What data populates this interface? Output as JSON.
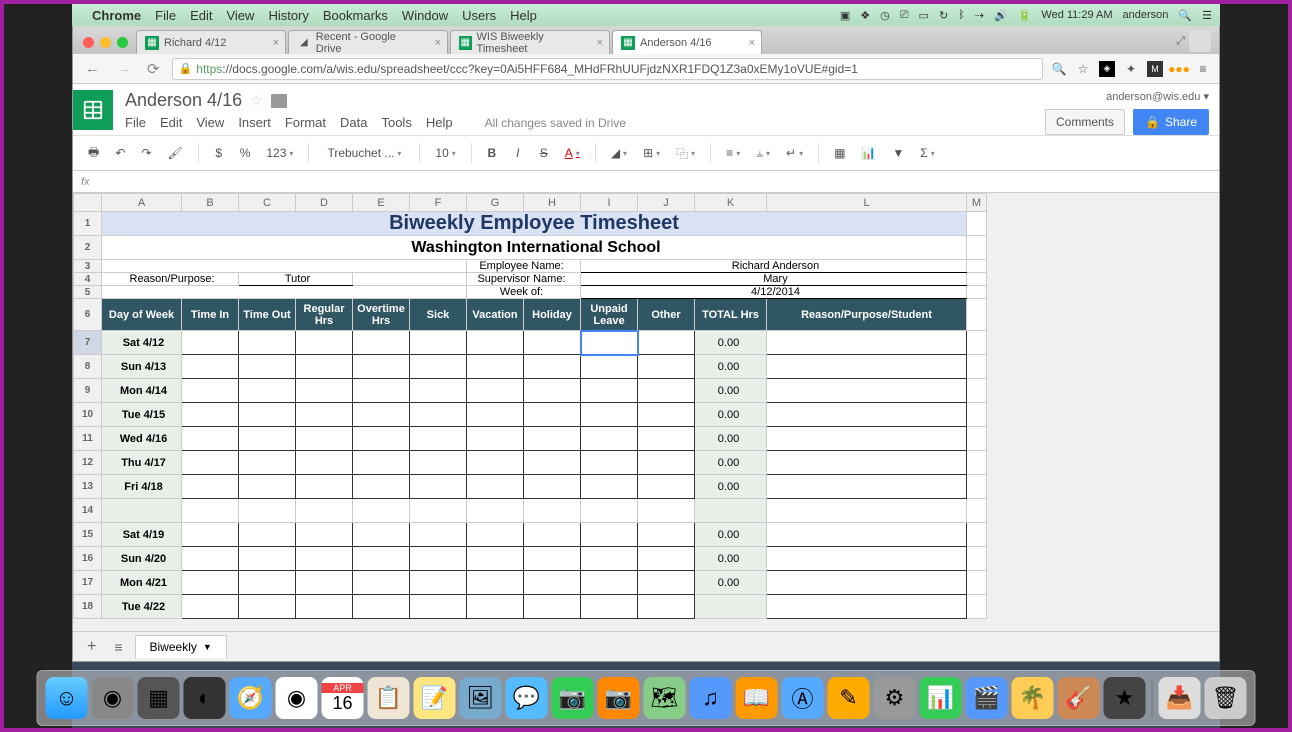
{
  "menubar": {
    "app": "Chrome",
    "menus": [
      "File",
      "Edit",
      "View",
      "History",
      "Bookmarks",
      "Window",
      "Users",
      "Help"
    ],
    "clock": "Wed 11:29 AM",
    "user": "anderson"
  },
  "tabs": [
    {
      "title": "Richard 4/12",
      "icon": "sheets",
      "active": false
    },
    {
      "title": "Recent - Google Drive",
      "icon": "drive",
      "active": false
    },
    {
      "title": "WIS Biweekly Timesheet",
      "icon": "sheets",
      "active": false
    },
    {
      "title": "Anderson 4/16",
      "icon": "sheets",
      "active": true
    }
  ],
  "url": {
    "scheme": "https",
    "path": "://docs.google.com/a/wis.edu/spreadsheet/ccc?key=0Ai5HFF684_MHdFRhUUFjdzNXR1FDQ1Z3a0xEMy1oVUE#gid=1"
  },
  "docs": {
    "title": "Anderson 4/16",
    "user": "anderson@wis.edu",
    "menus": [
      "File",
      "Edit",
      "View",
      "Insert",
      "Format",
      "Data",
      "Tools",
      "Help"
    ],
    "status": "All changes saved in Drive",
    "comments": "Comments",
    "share": "Share"
  },
  "toolbar": {
    "font": "Trebuchet ...",
    "size": "10",
    "fmt_currency": "$",
    "fmt_percent": "%",
    "fmt_number": "123"
  },
  "sheet": {
    "columns": [
      "A",
      "B",
      "C",
      "D",
      "E",
      "F",
      "G",
      "H",
      "I",
      "J",
      "K",
      "L",
      "M"
    ],
    "title": "Biweekly Employee Timesheet",
    "school": "Washington International School",
    "emp_name_label": "Employee Name:",
    "emp_name": "Richard Anderson",
    "sup_name_label": "Supervisor Name:",
    "sup_name": "Mary",
    "reason_label": "Reason/Purpose:",
    "reason": "Tutor",
    "week_label": "Week of:",
    "week": "4/12/2014",
    "headers": [
      "Day of Week",
      "Time In",
      "Time Out",
      "Regular Hrs",
      "Overtime Hrs",
      "Sick",
      "Vacation",
      "Holiday",
      "Unpaid Leave",
      "Other",
      "TOTAL Hrs",
      "Reason/Purpose/Student"
    ],
    "rows": [
      {
        "n": 7,
        "day": "Sat 4/12",
        "total": "0.00"
      },
      {
        "n": 8,
        "day": "Sun 4/13",
        "total": "0.00"
      },
      {
        "n": 9,
        "day": "Mon 4/14",
        "total": "0.00"
      },
      {
        "n": 10,
        "day": "Tue 4/15",
        "total": "0.00"
      },
      {
        "n": 11,
        "day": "Wed 4/16",
        "total": "0.00"
      },
      {
        "n": 12,
        "day": "Thu 4/17",
        "total": "0.00"
      },
      {
        "n": 13,
        "day": "Fri 4/18",
        "total": "0.00"
      }
    ],
    "blank_row": 14,
    "rows2": [
      {
        "n": 15,
        "day": "Sat 4/19",
        "total": "0.00"
      },
      {
        "n": 16,
        "day": "Sun 4/20",
        "total": "0.00"
      },
      {
        "n": 17,
        "day": "Mon 4/21",
        "total": "0.00"
      },
      {
        "n": 18,
        "day": "Tue 4/22",
        "total": ""
      }
    ],
    "tab": "Biweekly"
  },
  "colwidths": {
    "A": 80,
    "B": 57,
    "C": 57,
    "D": 57,
    "E": 57,
    "F": 57,
    "G": 57,
    "H": 57,
    "I": 57,
    "J": 57,
    "K": 72,
    "L": 200,
    "M": 20
  }
}
